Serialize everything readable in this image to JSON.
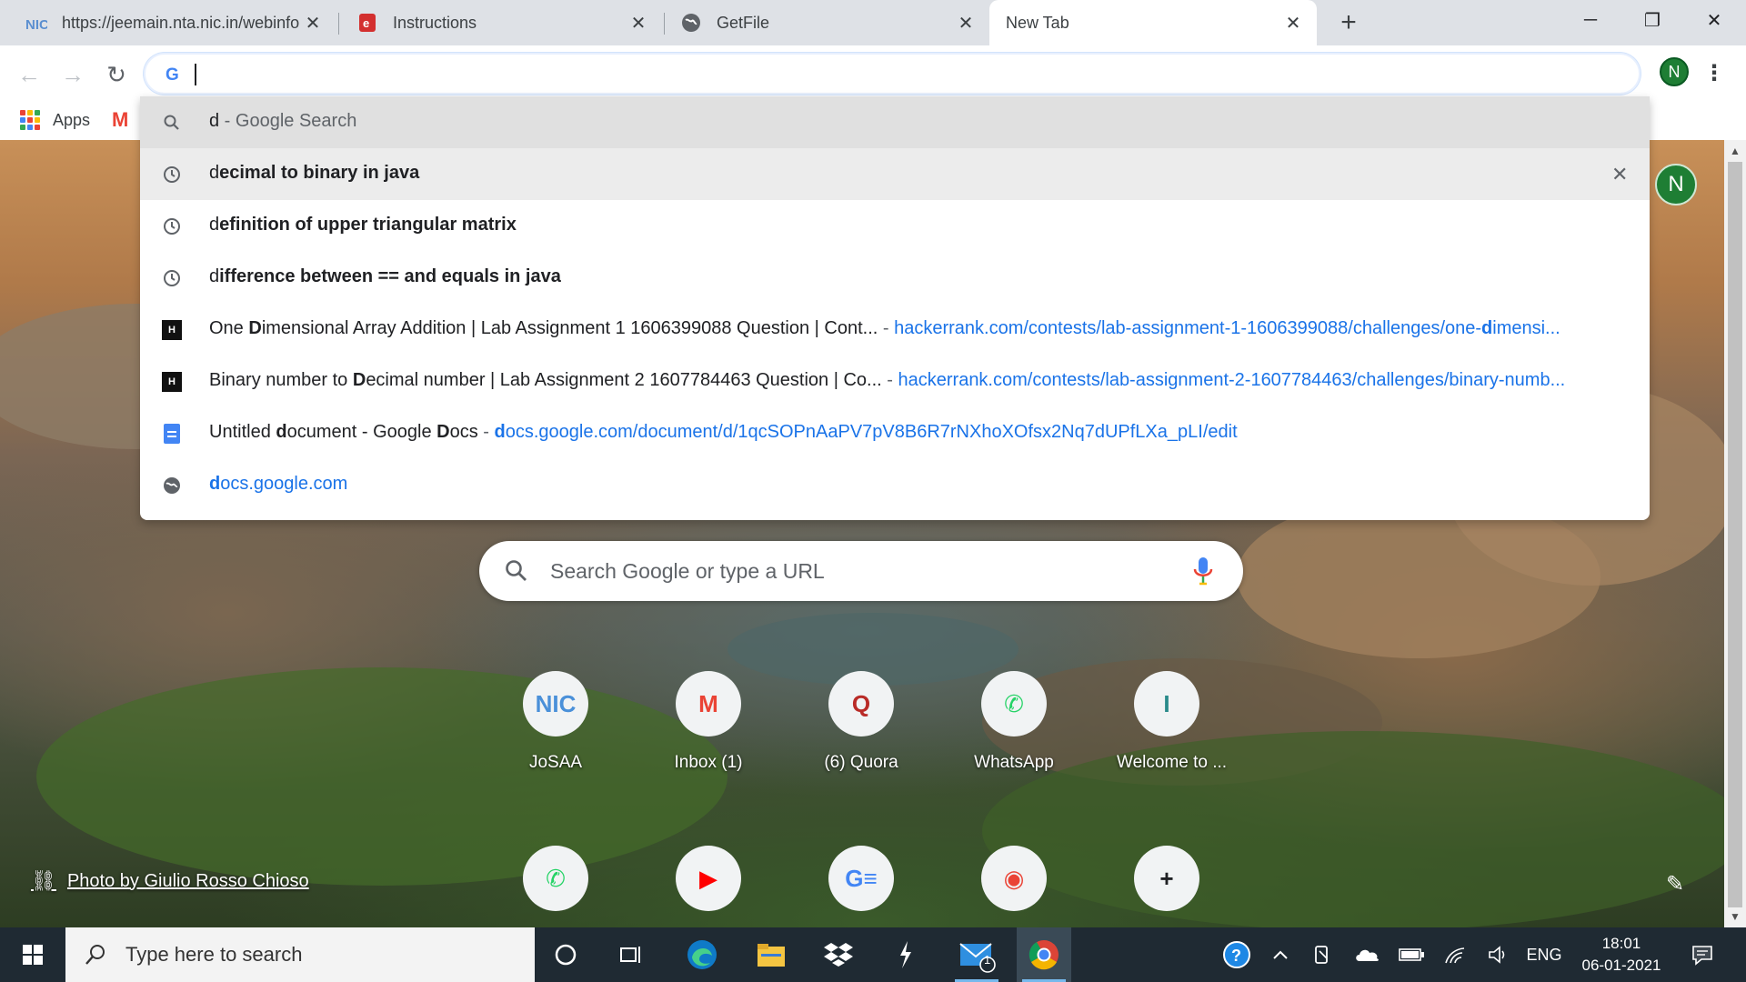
{
  "tabs": [
    {
      "title": "https://jeemain.nta.nic.in/webinfo",
      "favicon": "nic-icon"
    },
    {
      "title": "Instructions",
      "favicon": "instructions-icon"
    },
    {
      "title": "GetFile",
      "favicon": "globe-icon"
    },
    {
      "title": "New Tab",
      "favicon": "none",
      "active": true
    }
  ],
  "tab_close_glyph": "✕",
  "new_tab_glyph": "+",
  "window": {
    "minimize": "─",
    "restore": "❐",
    "close": "✕"
  },
  "nav": {
    "back": "←",
    "forward": "→",
    "reload": "↻"
  },
  "omnibox": {
    "value": ""
  },
  "profile_initial": "N",
  "menu_glyph": "⋮",
  "bookmarks": {
    "apps_label": "Apps",
    "gmail_glyph": "M"
  },
  "suggestions": [
    {
      "type": "search",
      "prefix": "d",
      "rest": "",
      "suffix": " - Google Search",
      "url": ""
    },
    {
      "type": "history",
      "prefix": "d",
      "rest": "ecimal to binary in java",
      "suffix": "",
      "url": ""
    },
    {
      "type": "history",
      "prefix": "d",
      "rest": "efinition of upper triangular matrix",
      "suffix": "",
      "url": ""
    },
    {
      "type": "history",
      "prefix": "d",
      "rest": "ifference between == and equals in java",
      "suffix": "",
      "url": ""
    },
    {
      "type": "bookmark",
      "pre": "One ",
      "bold": "D",
      "post": "imensional Array Addition | Lab Assignment 1 1606399088 Question | Cont...",
      "sep": " - ",
      "url_pre": "hackerrank.com/contests/lab-assignment-1-1606399088/challenges/one-",
      "url_bold": "d",
      "url_post": "imensi..."
    },
    {
      "type": "bookmark",
      "pre": "Binary number to ",
      "bold": "D",
      "post": "ecimal number | Lab Assignment 2 1607784463 Question | Co...",
      "sep": " - ",
      "url_pre": "hackerrank.com/contests/lab-assignment-2-1607784463/challenges/binary-numb...",
      "url_bold": "",
      "url_post": ""
    },
    {
      "type": "docs",
      "pre": "Untitled ",
      "bold": "d",
      "post": "ocument - Google ",
      "bold2": "D",
      "post2": "ocs",
      "sep": " - ",
      "url_bold": "d",
      "url_post": "ocs.google.com/document/d/1qcSOPnAaPV7pV8B6R7rNXhoXOfsx2Nq7dUPfLXa_pLI/edit"
    },
    {
      "type": "site",
      "url_bold": "d",
      "url_post": "ocs.google.com"
    }
  ],
  "suggestion_remove_glyph": "✕",
  "ntp": {
    "search_placeholder": "Search Google or type a URL",
    "shortcuts_row1": [
      {
        "label": "JoSAA",
        "icon": "nic-icon",
        "glyph": "NIC",
        "color": "#4a90d9"
      },
      {
        "label": "Inbox (1)",
        "icon": "gmail-icon",
        "glyph": "M",
        "color": "#ea4335"
      },
      {
        "label": "(6) Quora",
        "icon": "quora-icon",
        "glyph": "Q",
        "color": "#b92b27"
      },
      {
        "label": "WhatsApp",
        "icon": "whatsapp-icon",
        "glyph": "✆",
        "color": "#25d366"
      },
      {
        "label": "Welcome to ...",
        "icon": "letter-i-icon",
        "glyph": "I",
        "color": "#2a8a8a"
      }
    ],
    "shortcuts_row2": [
      {
        "icon": "whatsapp-icon",
        "glyph": "✆",
        "color": "#25d366"
      },
      {
        "icon": "youtube-icon",
        "glyph": "▶",
        "color": "#ff0000"
      },
      {
        "icon": "google-news-icon",
        "glyph": "G≡",
        "color": "#4285f4"
      },
      {
        "icon": "google-maps-icon",
        "glyph": "◉",
        "color": "#ea4335"
      },
      {
        "icon": "add-shortcut-icon",
        "glyph": "+",
        "color": "#202124"
      }
    ],
    "photo_credit": "Photo by Giulio Rosso Chioso",
    "link_glyph": "⛓",
    "pencil_glyph": "✎"
  },
  "taskbar": {
    "search_placeholder": "Type here to search",
    "lang": "ENG",
    "time": "18:01",
    "date": "06-01-2021",
    "mail_badge": "1"
  }
}
